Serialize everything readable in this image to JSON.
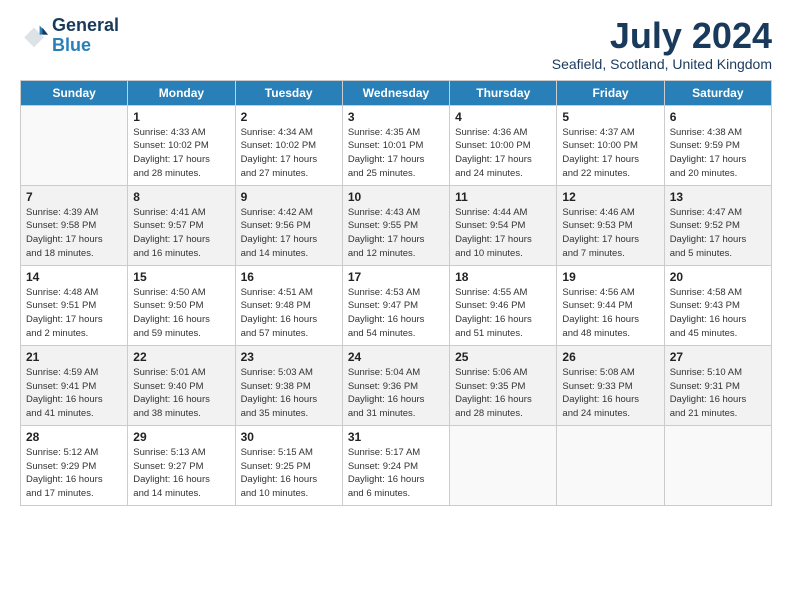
{
  "logo": {
    "line1": "General",
    "line2": "Blue"
  },
  "title": "July 2024",
  "location": "Seafield, Scotland, United Kingdom",
  "days_of_week": [
    "Sunday",
    "Monday",
    "Tuesday",
    "Wednesday",
    "Thursday",
    "Friday",
    "Saturday"
  ],
  "weeks": [
    [
      {
        "day": "",
        "info": ""
      },
      {
        "day": "1",
        "info": "Sunrise: 4:33 AM\nSunset: 10:02 PM\nDaylight: 17 hours\nand 28 minutes."
      },
      {
        "day": "2",
        "info": "Sunrise: 4:34 AM\nSunset: 10:02 PM\nDaylight: 17 hours\nand 27 minutes."
      },
      {
        "day": "3",
        "info": "Sunrise: 4:35 AM\nSunset: 10:01 PM\nDaylight: 17 hours\nand 25 minutes."
      },
      {
        "day": "4",
        "info": "Sunrise: 4:36 AM\nSunset: 10:00 PM\nDaylight: 17 hours\nand 24 minutes."
      },
      {
        "day": "5",
        "info": "Sunrise: 4:37 AM\nSunset: 10:00 PM\nDaylight: 17 hours\nand 22 minutes."
      },
      {
        "day": "6",
        "info": "Sunrise: 4:38 AM\nSunset: 9:59 PM\nDaylight: 17 hours\nand 20 minutes."
      }
    ],
    [
      {
        "day": "7",
        "info": "Sunrise: 4:39 AM\nSunset: 9:58 PM\nDaylight: 17 hours\nand 18 minutes."
      },
      {
        "day": "8",
        "info": "Sunrise: 4:41 AM\nSunset: 9:57 PM\nDaylight: 17 hours\nand 16 minutes."
      },
      {
        "day": "9",
        "info": "Sunrise: 4:42 AM\nSunset: 9:56 PM\nDaylight: 17 hours\nand 14 minutes."
      },
      {
        "day": "10",
        "info": "Sunrise: 4:43 AM\nSunset: 9:55 PM\nDaylight: 17 hours\nand 12 minutes."
      },
      {
        "day": "11",
        "info": "Sunrise: 4:44 AM\nSunset: 9:54 PM\nDaylight: 17 hours\nand 10 minutes."
      },
      {
        "day": "12",
        "info": "Sunrise: 4:46 AM\nSunset: 9:53 PM\nDaylight: 17 hours\nand 7 minutes."
      },
      {
        "day": "13",
        "info": "Sunrise: 4:47 AM\nSunset: 9:52 PM\nDaylight: 17 hours\nand 5 minutes."
      }
    ],
    [
      {
        "day": "14",
        "info": "Sunrise: 4:48 AM\nSunset: 9:51 PM\nDaylight: 17 hours\nand 2 minutes."
      },
      {
        "day": "15",
        "info": "Sunrise: 4:50 AM\nSunset: 9:50 PM\nDaylight: 16 hours\nand 59 minutes."
      },
      {
        "day": "16",
        "info": "Sunrise: 4:51 AM\nSunset: 9:48 PM\nDaylight: 16 hours\nand 57 minutes."
      },
      {
        "day": "17",
        "info": "Sunrise: 4:53 AM\nSunset: 9:47 PM\nDaylight: 16 hours\nand 54 minutes."
      },
      {
        "day": "18",
        "info": "Sunrise: 4:55 AM\nSunset: 9:46 PM\nDaylight: 16 hours\nand 51 minutes."
      },
      {
        "day": "19",
        "info": "Sunrise: 4:56 AM\nSunset: 9:44 PM\nDaylight: 16 hours\nand 48 minutes."
      },
      {
        "day": "20",
        "info": "Sunrise: 4:58 AM\nSunset: 9:43 PM\nDaylight: 16 hours\nand 45 minutes."
      }
    ],
    [
      {
        "day": "21",
        "info": "Sunrise: 4:59 AM\nSunset: 9:41 PM\nDaylight: 16 hours\nand 41 minutes."
      },
      {
        "day": "22",
        "info": "Sunrise: 5:01 AM\nSunset: 9:40 PM\nDaylight: 16 hours\nand 38 minutes."
      },
      {
        "day": "23",
        "info": "Sunrise: 5:03 AM\nSunset: 9:38 PM\nDaylight: 16 hours\nand 35 minutes."
      },
      {
        "day": "24",
        "info": "Sunrise: 5:04 AM\nSunset: 9:36 PM\nDaylight: 16 hours\nand 31 minutes."
      },
      {
        "day": "25",
        "info": "Sunrise: 5:06 AM\nSunset: 9:35 PM\nDaylight: 16 hours\nand 28 minutes."
      },
      {
        "day": "26",
        "info": "Sunrise: 5:08 AM\nSunset: 9:33 PM\nDaylight: 16 hours\nand 24 minutes."
      },
      {
        "day": "27",
        "info": "Sunrise: 5:10 AM\nSunset: 9:31 PM\nDaylight: 16 hours\nand 21 minutes."
      }
    ],
    [
      {
        "day": "28",
        "info": "Sunrise: 5:12 AM\nSunset: 9:29 PM\nDaylight: 16 hours\nand 17 minutes."
      },
      {
        "day": "29",
        "info": "Sunrise: 5:13 AM\nSunset: 9:27 PM\nDaylight: 16 hours\nand 14 minutes."
      },
      {
        "day": "30",
        "info": "Sunrise: 5:15 AM\nSunset: 9:25 PM\nDaylight: 16 hours\nand 10 minutes."
      },
      {
        "day": "31",
        "info": "Sunrise: 5:17 AM\nSunset: 9:24 PM\nDaylight: 16 hours\nand 6 minutes."
      },
      {
        "day": "",
        "info": ""
      },
      {
        "day": "",
        "info": ""
      },
      {
        "day": "",
        "info": ""
      }
    ]
  ]
}
